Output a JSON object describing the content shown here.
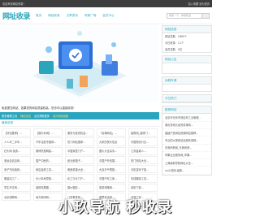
{
  "topbar": {
    "welcome": "欢迎来到网站收录！",
    "right": "加入收藏  设为首页"
  },
  "logo": "网址收录",
  "nav": [
    "首页",
    "网站收录",
    "文章资讯",
    "时新广场",
    "会员中心"
  ],
  "search": {
    "placeholder": "搜索一下，你就知道"
  },
  "hero": {
    "desc": "免费提交网站，如果您的网站质量较高，您也可以直接收录！"
  },
  "links": [
    "更多管理工具",
    "网站总站",
    "点击获取更多",
    "高分网站链接"
  ],
  "section_title": "最新收录",
  "grid": [
    "【好站推荐】...",
    "【娱乐休闲】...",
    "服务与投资机会…",
    "「高端网站」…",
    "建筑网_装修门…",
    "人人车二手车...",
    "汽车名胜专题网...",
    "热门网站推荐...",
    "大家的快乐信息",
    "中国物流行业...",
    "石头网-免费...",
    "微博热搜明星...",
    "中国家居门户...",
    "图片大全高清...",
    "江苏盐城人...",
    "奥运会信息网...",
    "国产中医药...",
    "纸业纸箱子...",
    "中国户外拓展...",
    "热门网站大全...",
    "电子书阅读网...",
    "网店装修工具...",
    "美食菜谱大全...",
    "大连天气预报...",
    "手机游戏下载...",
    "服装加工厂...",
    "长沙本地导航...",
    "化工行业门户...",
    "中国汽车之家...",
    "在线翻译工具...",
    "学生作文网...",
    "装修效果图...",
    "婚纱摄影...",
    "旅游攻略网...",
    "电影下载...",
    "北京招聘网...",
    "地方新闻网...",
    "儿童教育网...",
    "股票资讯网...",
    "动漫之家..."
  ],
  "stats": {
    "title": "网站信息",
    "lines": [
      "网站总数：1865个",
      "今日收录：11个",
      "会员总数：0位"
    ]
  },
  "sidebox1": "网站公告",
  "sidebox2": "远程车源",
  "sidebox3": "今日热门",
  "sidebox4": "推荐网站",
  "side_list": [
    "北京市光伏市场应商工业管理...",
    "湖北省地元素的收录网...",
    "福建产品网站资源网站推荐...",
    "专业的大型网站全部收录网...",
    "东莞商贸网_东莞商贸...",
    "苹果企业服务网_苹果...",
    "上海最新导航网址大全...",
    "uu小说网-最新..."
  ],
  "watermark": "小玖导航 秒收录"
}
